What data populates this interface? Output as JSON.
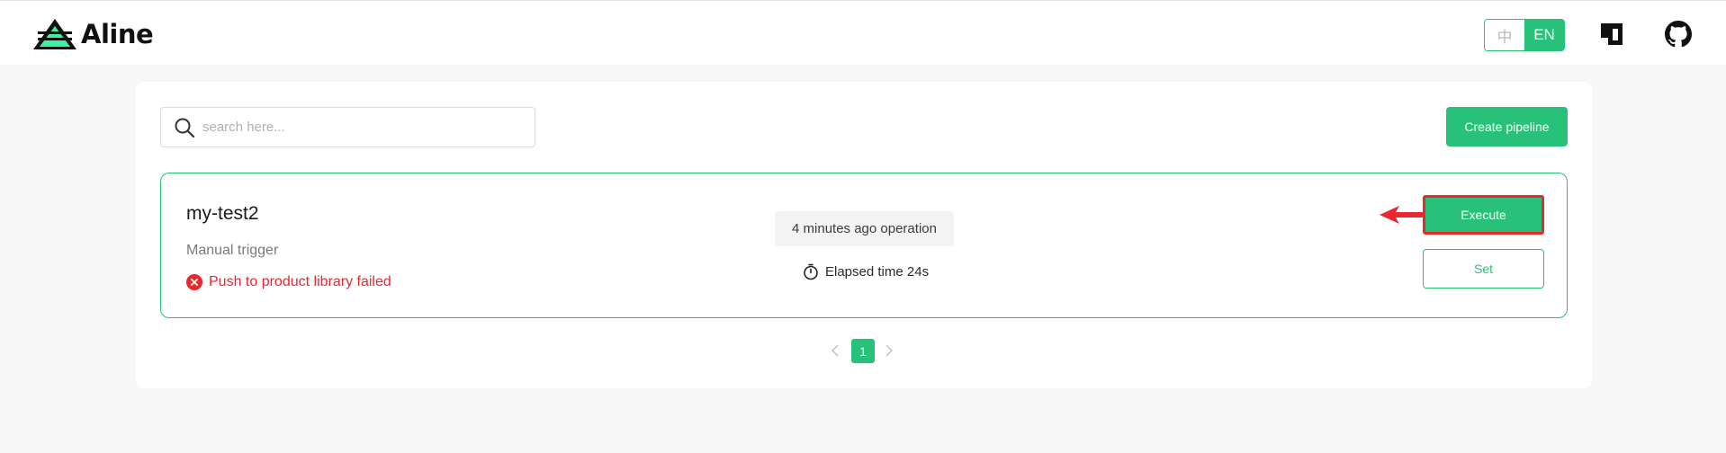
{
  "header": {
    "logo_text": "Aline",
    "lang_zh": "中",
    "lang_en": "EN",
    "active_lang": "EN"
  },
  "toolbar": {
    "search_placeholder": "search here...",
    "search_value": "",
    "create_label": "Create pipeline"
  },
  "pipeline": {
    "name": "my-test2",
    "trigger": "Manual trigger",
    "status_text": "Push to product library failed",
    "status": "failed",
    "operation": "4 minutes ago operation",
    "elapsed": "Elapsed time 24s",
    "execute_label": "Execute",
    "set_label": "Set"
  },
  "pagination": {
    "current_page": "1"
  },
  "colors": {
    "accent": "#27c179",
    "error": "#e8272f",
    "highlight": "#e8272f",
    "background": "#f7f7f7"
  },
  "icons": {
    "logo": "aline-logo-icon",
    "notion": "notion-icon",
    "github": "github-icon",
    "search": "search-icon",
    "status": "error-circle-icon",
    "timer": "stopwatch-icon",
    "annotation": "red-arrow-icon",
    "prev": "chevron-left-icon",
    "next": "chevron-right-icon"
  }
}
